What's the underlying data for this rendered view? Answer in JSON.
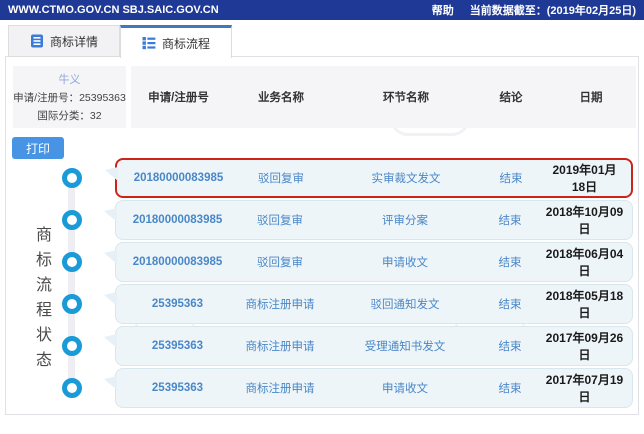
{
  "top_bar": {
    "urls": "WWW.CTMO.GOV.CN SBJ.SAIC.GOV.CN",
    "help_label": "帮助",
    "data_cutoff": "当前数据截至：(2019年02月25日)"
  },
  "tabs": [
    {
      "label": "商标详情",
      "icon": "document-icon",
      "active": false
    },
    {
      "label": "商标流程",
      "icon": "list-icon",
      "active": true
    }
  ],
  "info": {
    "name": "牛义",
    "reg_line": "申请/注册号：25395363",
    "class_line": "国际分类：32"
  },
  "print": {
    "label": "打印"
  },
  "sidebar": {
    "vertical_label": "商标流程状态"
  },
  "table": {
    "headers": [
      "申请/注册号",
      "业务名称",
      "环节名称",
      "结论",
      "日期"
    ],
    "rows": [
      {
        "reg_no": "20180000083985",
        "business": "驳回复审",
        "step": "实审裁文发文",
        "conclusion": "结束",
        "date": "2019年01月18日",
        "highlighted": true
      },
      {
        "reg_no": "20180000083985",
        "business": "驳回复审",
        "step": "评审分案",
        "conclusion": "结束",
        "date": "2018年10月09日",
        "highlighted": false
      },
      {
        "reg_no": "20180000083985",
        "business": "驳回复审",
        "step": "申请收文",
        "conclusion": "结束",
        "date": "2018年06月04日",
        "highlighted": false
      },
      {
        "reg_no": "25395363",
        "business": "商标注册申请",
        "step": "驳回通知发文",
        "conclusion": "结束",
        "date": "2018年05月18日",
        "highlighted": false
      },
      {
        "reg_no": "25395363",
        "business": "商标注册申请",
        "step": "受理通知书发文",
        "conclusion": "结束",
        "date": "2017年09月26日",
        "highlighted": false
      },
      {
        "reg_no": "25395363",
        "business": "商标注册申请",
        "step": "申请收文",
        "conclusion": "结束",
        "date": "2017年07月19日",
        "highlighted": false
      }
    ]
  },
  "colors": {
    "top_bar_bg": "#1e3a96",
    "accent_blue": "#4794e4",
    "tab_active_border": "#4078c0",
    "cell_text_blue": "#4a87c6",
    "timeline_ring_blue": "#1a9bd8",
    "highlight_red": "#cc2418",
    "row_bg": "#edf5f9",
    "header_bg": "#f5f5f7"
  }
}
